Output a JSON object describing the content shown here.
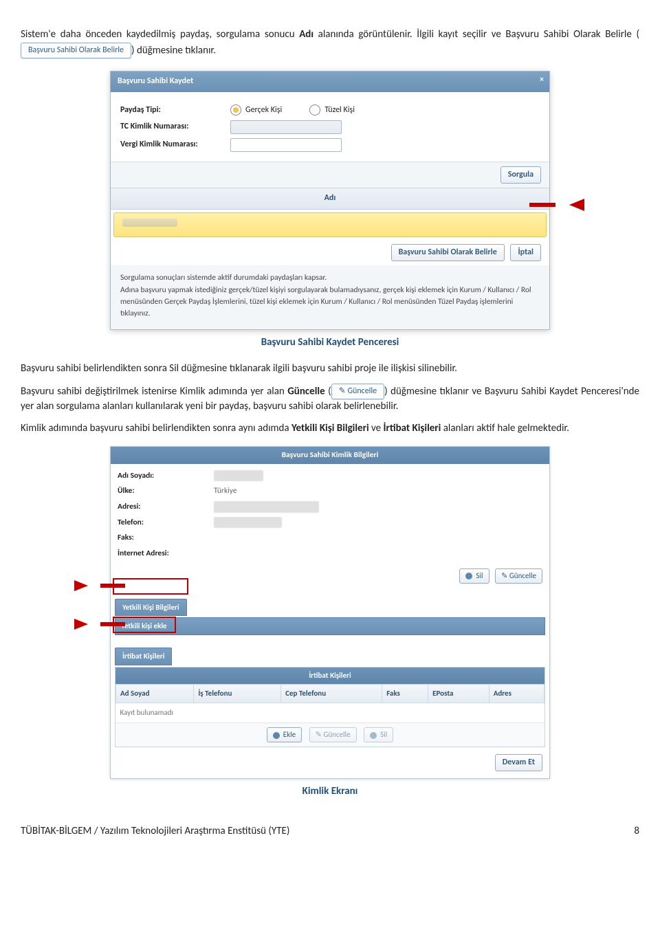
{
  "para": {
    "p1a": "Sistem'e daha önceden kaydedilmiş paydaş, sorgulama sonucu ",
    "p1_bold": "Adı",
    "p1b": " alanında görüntülenir. İlgili kayıt seçilir ve Başvuru Sahibi Olarak Belirle (",
    "p1c": ") düğmesine tıklanır.",
    "p2": "Başvuru sahibi belirlendikten sonra Sil düğmesine tıklanarak ilgili başvuru sahibi proje ile ilişkisi silinebilir.",
    "p3a": "Başvuru sahibi değiştirilmek istenirse Kimlik adımında yer alan ",
    "p3_bold": "Güncelle",
    "p3b": " (",
    "p3c": ") düğmesine tıklanır ve Başvuru Sahibi Kaydet Penceresi'nde yer alan sorgulama alanları kullanılarak yeni bir paydaş, başvuru sahibi olarak belirlenebilir.",
    "p4a": "Kimlik adımında başvuru sahibi belirlendikten sonra aynı adımda ",
    "p4_b1": "Yetkili Kişi Bilgileri",
    "p4b": " ve ",
    "p4_b2": "İrtibat Kişileri",
    "p4c": " alanları aktif hale gelmektedir."
  },
  "inlineButtons": {
    "belirle": "Başvuru Sahibi Olarak Belirle",
    "guncelle": "Güncelle"
  },
  "captions": {
    "c1": "Başvuru Sahibi Kaydet Penceresi",
    "c2": "Kimlik Ekranı"
  },
  "dialog1": {
    "title": "Başvuru Sahibi Kaydet",
    "close": "×",
    "labels": {
      "tip": "Paydaş Tipi:",
      "tc": "TC Kimlik Numarası:",
      "vergi": "Vergi Kimlik Numarası:"
    },
    "radios": {
      "gercek": "Gerçek Kişi",
      "tuzel": "Tüzel Kişi"
    },
    "sorgula": "Sorgula",
    "adiHeader": "Adı",
    "belirleBtn": "Başvuru Sahibi Olarak Belirle",
    "iptal": "İptal",
    "info": "Sorgulama sonuçları sistemde aktif durumdaki paydaşları kapsar.\nAdına başvuru yapmak istediğiniz gerçek/tüzel kişiyi sorgulayarak bulamadıysanız, gerçek kişi eklemek için Kurum / Kullanıcı / Rol menüsünden Gerçek Paydaş İşlemlerini, tüzel kişi eklemek için Kurum / Kullanıcı / Rol menüsünden Tüzel Paydaş işlemlerini tıklayınız."
  },
  "panel2": {
    "title": "Başvuru Sahibi Kimlik Bilgileri",
    "rows": {
      "ad": "Adı Soyadı:",
      "ulke": "Ülke:",
      "ulke_v": "Türkiye",
      "adres": "Adresi:",
      "tel": "Telefon:",
      "faks": "Faks:",
      "web": "İnternet Adresi:"
    },
    "silBtn": "Sil",
    "guncBtn": "Güncelle",
    "yetkiliHeader": "Yetkili Kişi Bilgileri",
    "yetkiliEkle": "Yetkili kişi ekle",
    "irtibatHeader": "İrtibat Kişileri",
    "irtibatTitle": "İrtibat Kişileri",
    "cols": {
      "c1": "Ad Soyad",
      "c2": "İş Telefonu",
      "c3": "Cep Telefonu",
      "c4": "Faks",
      "c5": "EPosta",
      "c6": "Adres"
    },
    "noRecord": "Kayıt bulunamadı",
    "ekle": "Ekle",
    "gunc": "Güncelle",
    "sil": "Sil",
    "devam": "Devam Et"
  },
  "footer": {
    "left": "TÜBİTAK-BİLGEM / Yazılım Teknolojileri Araştırma Enstitüsü (YTE)",
    "right": "8"
  }
}
